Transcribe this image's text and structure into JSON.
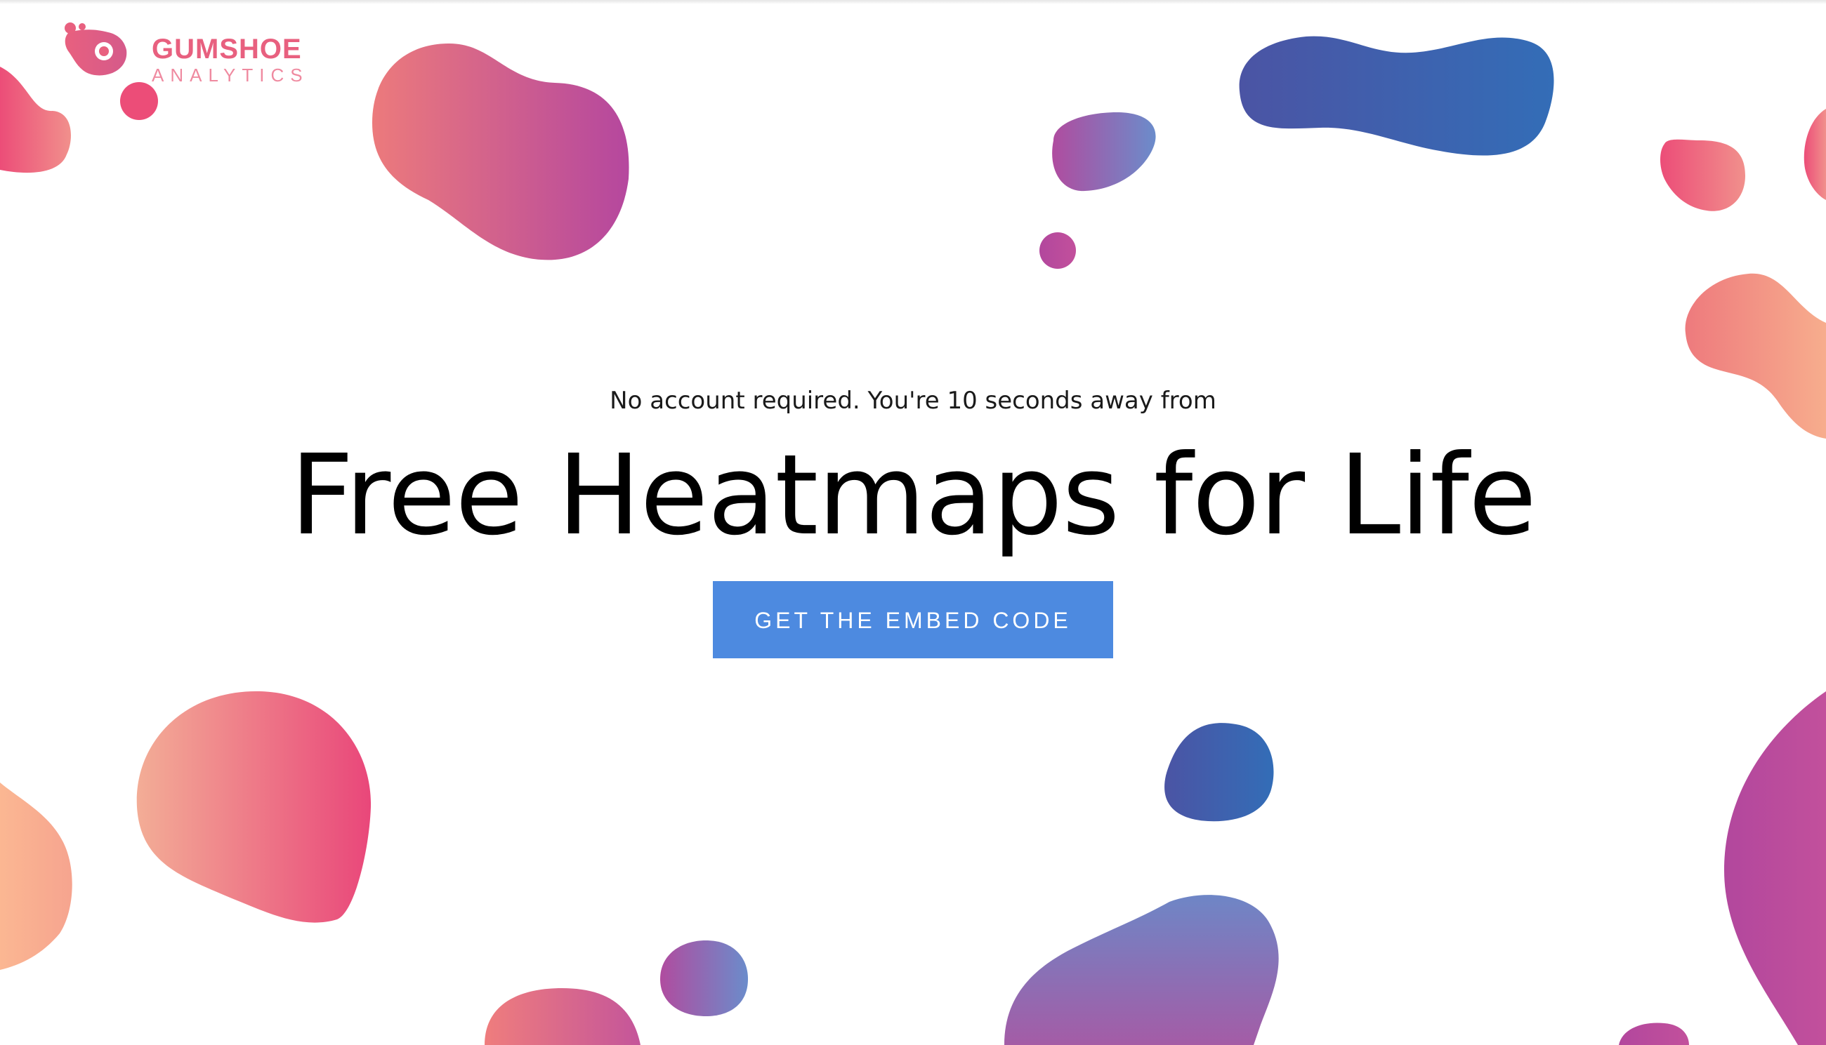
{
  "brand": {
    "name_line1": "GUMSHOE",
    "name_line2": "ANALYTICS",
    "primary_color": "#e8607f",
    "secondary_color": "#ef8aa0"
  },
  "hero": {
    "subtitle": "No account required. You're 10 seconds away from",
    "title": "Free Heatmaps for Life",
    "cta_label": "GET THE EMBED CODE",
    "cta_color": "#4d8ae0"
  },
  "decoration": {
    "style": "gradient-blobs",
    "gradient_colors": [
      "#ec4d78",
      "#f08a84",
      "#b7479e",
      "#8b7fc2",
      "#3a6cb6",
      "#4b54a4",
      "#f6b391"
    ]
  }
}
